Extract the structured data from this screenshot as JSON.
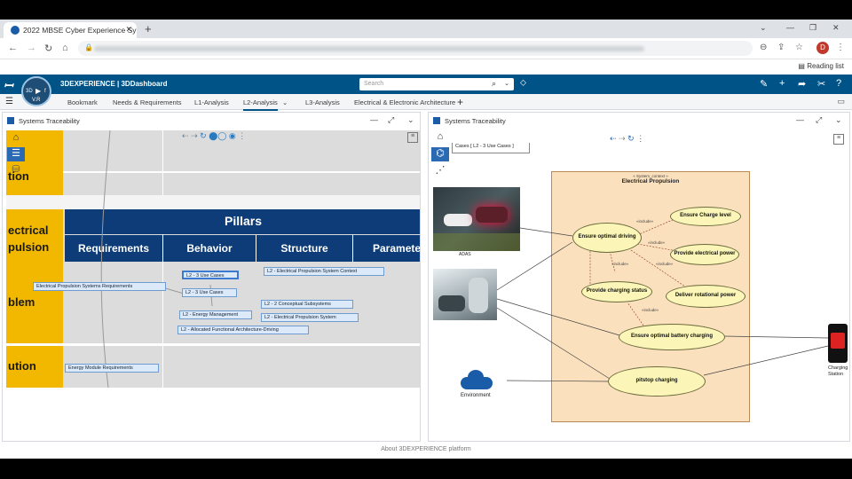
{
  "browser": {
    "tab_title": "2022 MBSE Cyber Experience Sy",
    "reading_list": "Reading list",
    "avatar": "D"
  },
  "app": {
    "brand": "3DEXPERIENCE | 3DDashboard",
    "search_placeholder": "Search",
    "compass_version": "V.R",
    "footer": "About 3DEXPERIENCE platform"
  },
  "tabs": [
    "Bookmark",
    "Needs & Requirements",
    "L1-Analysis",
    "L2-Analysis",
    "L3-Analysis",
    "Electrical & Electronic Architecture"
  ],
  "left_panel": {
    "title": "Systems Traceability",
    "rows": [
      "tion",
      "ectrical\npulsion",
      "blem",
      "ution"
    ],
    "pillars": "Pillars",
    "columns": [
      "Requirements",
      "Behavior",
      "Structure",
      "Paramete"
    ],
    "nodes": {
      "req1": "Electrical Propulsion Systems Requirements",
      "req2": "Energy Module Requirements",
      "uc1": "L2 - 3 Use Cases",
      "uc2": "L2 - 3 Use Cases",
      "energy": "L2 - Energy Management",
      "alloc": "L2 - Allocated Functional Architecture-Driving",
      "ctx": "L2 - Electrical Propulsion System Context",
      "concept": "L2 - 2 Conceptual Subsystems",
      "eps": "L2 - Electrical Propulsion System"
    }
  },
  "right_panel": {
    "title": "Systems Traceability",
    "breadcrumb": "Cases [ L2 - 3 Use Cases ]",
    "system_stereo": "« System_context »",
    "system_name": "Electrical Propulsion",
    "usecases": {
      "ensure_optimal": "Ensure optimal driving",
      "charge_level": "Ensure Charge level",
      "electrical_power": "Provide electrical power",
      "charging_status": "Provide charging status",
      "rotational_power": "Deliver rotational power",
      "battery_charging": "Ensure optimal battery charging",
      "pitstop": "pitstop charging"
    },
    "include": "«include»",
    "actors": {
      "adas": "ADAS",
      "environment": "Environment",
      "charging_station": "Charging Station"
    }
  }
}
